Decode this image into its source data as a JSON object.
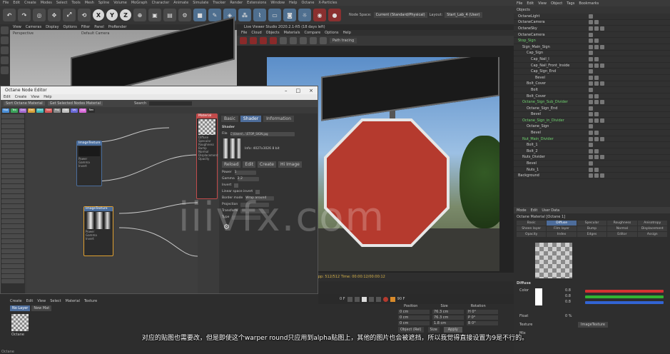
{
  "menubar": [
    "File",
    "Edit",
    "Create",
    "Modes",
    "Select",
    "Tools",
    "Mesh",
    "Spline",
    "Volume",
    "MoGraph",
    "Character",
    "Animate",
    "Simulate",
    "Tracker",
    "Render",
    "Extensions",
    "Window",
    "Help",
    "Octane",
    "X-Particles"
  ],
  "toolbar": {
    "axis_buttons": [
      "X",
      "Y",
      "Z"
    ],
    "node_space_label": "Node Space:",
    "node_space_value": "Current (Standard/Physical)",
    "layout_label": "Layout:",
    "layout_value": "Start_Lab_4 (User)"
  },
  "viewport": {
    "menus": [
      "View",
      "Cameras",
      "Display",
      "Options",
      "Filter",
      "Panel",
      "ProRender"
    ],
    "camera_label": "Perspective",
    "camera_value": "Default Camera"
  },
  "node_editor": {
    "title": "Octane Node Editor",
    "menus": [
      "Edit",
      "Create",
      "View",
      "Help"
    ],
    "toolbar_items": [
      "Sort Octane Material",
      "Get Selected Nodes Material",
      "Search"
    ],
    "chip_labels": [
      "Mat",
      "Tex",
      "Geo",
      "Emi",
      "Med",
      "Tran",
      "Proj",
      "Oth",
      "Val",
      "Out",
      "Ren"
    ],
    "chip_colors": [
      "#4a8fd8",
      "#3aa35a",
      "#a56bd1",
      "#d8a23a",
      "#3fb8b8",
      "#d85a5a",
      "#8a8a8a",
      "#c0c0c0",
      "#6a6ad8",
      "#d86ad8",
      "#2d2d2d"
    ],
    "nodes": [
      {
        "title": "ImageTexture",
        "ports": [
          "Power",
          "Gamma",
          "Invert",
          "Border mode",
          "Projection",
          "Transform",
          "Type"
        ]
      },
      {
        "title": "ImageTexture",
        "ports": [
          "Power",
          "Gamma",
          "Invert",
          "Border mode",
          "Projection",
          "Transform",
          "Type"
        ]
      },
      {
        "title": "Material",
        "ports": [
          "Diffuse",
          "Specular",
          "Roughness",
          "Bump",
          "Normal",
          "Displacement",
          "Opacity",
          "Edges rounding"
        ]
      }
    ],
    "attr_tabs": [
      "Basic",
      "Shader",
      "Information"
    ],
    "attr_section": "Shader",
    "file_label": "File",
    "file_value": "C:\\Users\\...\\STOP_SIGN.jpg",
    "image_info": "Info: 4027x3026 8 bit",
    "buttons": [
      "Reload",
      "Edit",
      "Create",
      "Hi Image"
    ],
    "fields": [
      "Power",
      "Gamma",
      "Invert",
      "Linear space invert",
      "Border mode",
      "Projection",
      "Transform",
      "Type"
    ],
    "power_value": "1",
    "gamma_value": "2.2",
    "border_mode_value": "Wrap around"
  },
  "live_viewer": {
    "title": "Live Viewer Studio 2020.2.1-R5 (18 days left)",
    "menus": [
      "File",
      "Cloud",
      "Objects",
      "Materials",
      "Compare",
      "Options",
      "Help"
    ],
    "mode": "Path tracing",
    "status": "Rendering: 100%  Mesh: 4  Tri: 6.84k  Spp: 512/512  Time: 00:00:12/00:00:12"
  },
  "object_manager": {
    "menus": [
      "File",
      "Edit",
      "View",
      "Object",
      "Tags",
      "Bookmarks"
    ],
    "objects": [
      {
        "name": "OctaneLight",
        "indent": 0,
        "green": false
      },
      {
        "name": "OctaneCamera",
        "indent": 0,
        "green": false
      },
      {
        "name": "OctaneSky",
        "indent": 0,
        "green": false
      },
      {
        "name": "OctaneCamera",
        "indent": 0,
        "green": false
      },
      {
        "name": "Stop_Sign",
        "indent": 0,
        "green": true
      },
      {
        "name": "Sign_Main_Sign",
        "indent": 1,
        "green": false
      },
      {
        "name": "Cap_Sign",
        "indent": 2,
        "green": false
      },
      {
        "name": "Cap_Nail_I",
        "indent": 3,
        "green": false
      },
      {
        "name": "Cap_Nail_Front_Inside",
        "indent": 3,
        "green": false
      },
      {
        "name": "Cap_Sign_End",
        "indent": 3,
        "green": false
      },
      {
        "name": "Bevel",
        "indent": 4,
        "green": false
      },
      {
        "name": "Bolt_Cover",
        "indent": 2,
        "green": false
      },
      {
        "name": "Bolt",
        "indent": 3,
        "green": false
      },
      {
        "name": "Bolt_Cover",
        "indent": 2,
        "green": false
      },
      {
        "name": "Octane_Sign_Sub_Divider",
        "indent": 1,
        "green": true
      },
      {
        "name": "Octane_Sign_End",
        "indent": 2,
        "green": false
      },
      {
        "name": "Bevel",
        "indent": 3,
        "green": false
      },
      {
        "name": "Octane_Sign_in_Divider",
        "indent": 1,
        "green": true
      },
      {
        "name": "Octane_Sign",
        "indent": 2,
        "green": false
      },
      {
        "name": "Bevel",
        "indent": 3,
        "green": false
      },
      {
        "name": "Nut_Main_Divider",
        "indent": 1,
        "green": true
      },
      {
        "name": "Bolt_1",
        "indent": 2,
        "green": false
      },
      {
        "name": "Bolt_2",
        "indent": 2,
        "green": false
      },
      {
        "name": "Nuts_Divider",
        "indent": 1,
        "green": false
      },
      {
        "name": "Bevel",
        "indent": 2,
        "green": false
      },
      {
        "name": "Nuts_1",
        "indent": 2,
        "green": false
      },
      {
        "name": "Background",
        "indent": 0,
        "green": false
      }
    ]
  },
  "attribute_manager": {
    "menus": [
      "Mode",
      "Edit",
      "User Data"
    ],
    "title": "Octane Material [Octane 1]",
    "tabs": [
      "Basic",
      "Diffuse",
      "Specular",
      "Roughness",
      "Anisotropy",
      "Sheen layer",
      "Film layer",
      "Bump",
      "Normal",
      "Displacement",
      "Opacity",
      "Index",
      "Edges",
      "Editor",
      "Assign"
    ],
    "active_tab": "Diffuse",
    "section": "Diffuse",
    "color_label": "Color",
    "float_label": "Float",
    "texture_label": "Texture",
    "texture_value": "ImageTexture",
    "mix_label": "Mix",
    "rgb_values": [
      "0.8",
      "0.8",
      "0.8"
    ],
    "slider_colors": [
      "#d43232",
      "#32b432",
      "#3264d4"
    ],
    "float_value": "0 %"
  },
  "material_manager": {
    "menus": [
      "Create",
      "Edit",
      "View",
      "Select",
      "Material",
      "Texture"
    ],
    "layers": [
      "No Layer",
      "New Mat"
    ],
    "material_name": "Octane"
  },
  "coordinates": {
    "headers": [
      "Position",
      "Size",
      "Rotation"
    ],
    "rows": [
      {
        "pos": "0 cm",
        "size": "76.3 cm",
        "rot": "H 0°"
      },
      {
        "pos": "0 cm",
        "size": "76.3 cm",
        "rot": "P 0°"
      },
      {
        "pos": "0 cm",
        "size": "1.8 cm",
        "rot": "B 0°"
      }
    ],
    "mode_value": "Object (Rel)",
    "size_mode": "Size",
    "apply_label": "Apply"
  },
  "timeline": {
    "frame_start": "0 F",
    "frame_end": "90 F",
    "current": "0 F"
  },
  "subtitle": "对应的贴图也需要改，但是即使这个warper round只应用到alpha贴图上，其他的图片也会被遮挡，所以我觉得直接设置为9是不行的。",
  "watermark": "iiivfx.com",
  "status_bar": "Octane"
}
